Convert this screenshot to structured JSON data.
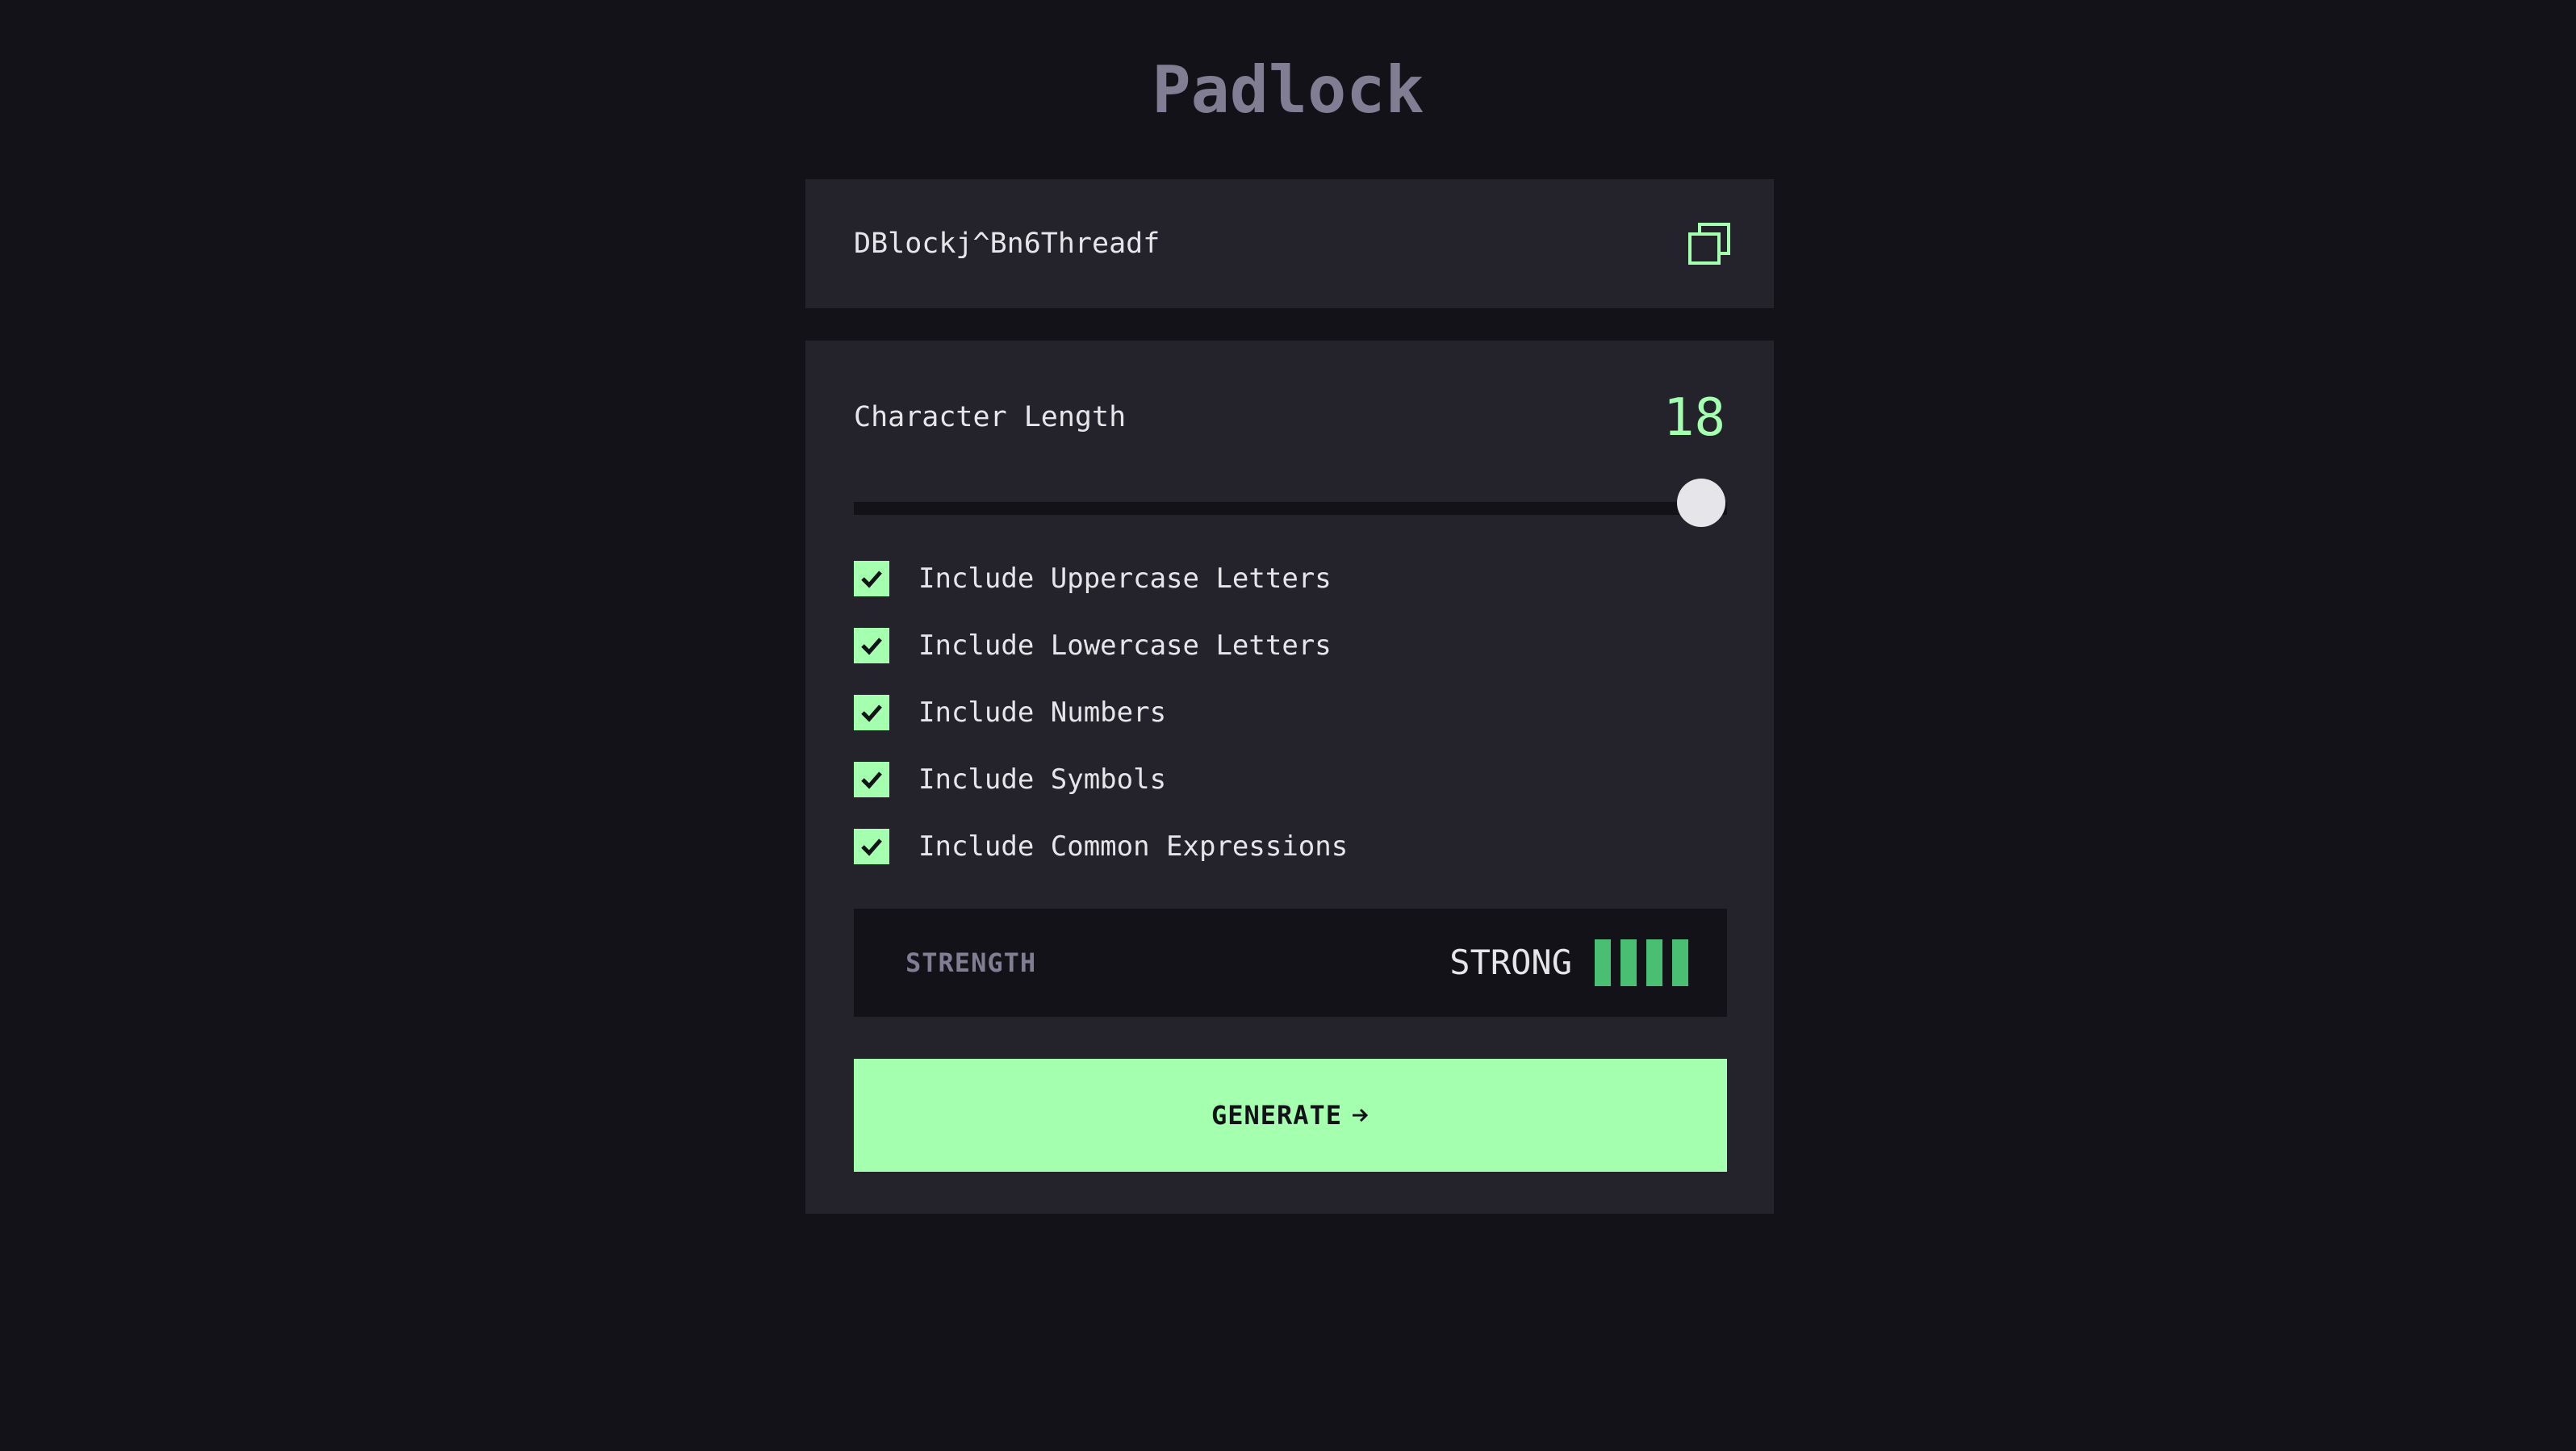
{
  "app": {
    "title": "Padlock"
  },
  "password": {
    "value": "DBlockj^Bn6Threadf",
    "copy_icon": "copy-icon"
  },
  "settings": {
    "length_label": "Character Length",
    "length_value": "18",
    "slider": {
      "value": 18,
      "level_fraction": 1.0
    },
    "options": [
      {
        "label": "Include Uppercase Letters",
        "checked": true
      },
      {
        "label": "Include Lowercase Letters",
        "checked": true
      },
      {
        "label": "Include Numbers",
        "checked": true
      },
      {
        "label": "Include Symbols",
        "checked": true
      },
      {
        "label": "Include Common Expressions",
        "checked": true
      }
    ],
    "strength": {
      "label": "STRENGTH",
      "value": "STRONG",
      "bars_filled": 4,
      "bars_total": 4
    },
    "generate_label": "GENERATE"
  },
  "colors": {
    "background": "#131219",
    "panel": "#24232C",
    "accent": "#A4FFAF",
    "text": "#E6E5EA",
    "muted": "#817D92",
    "strength_bar": "#4ABE73"
  }
}
